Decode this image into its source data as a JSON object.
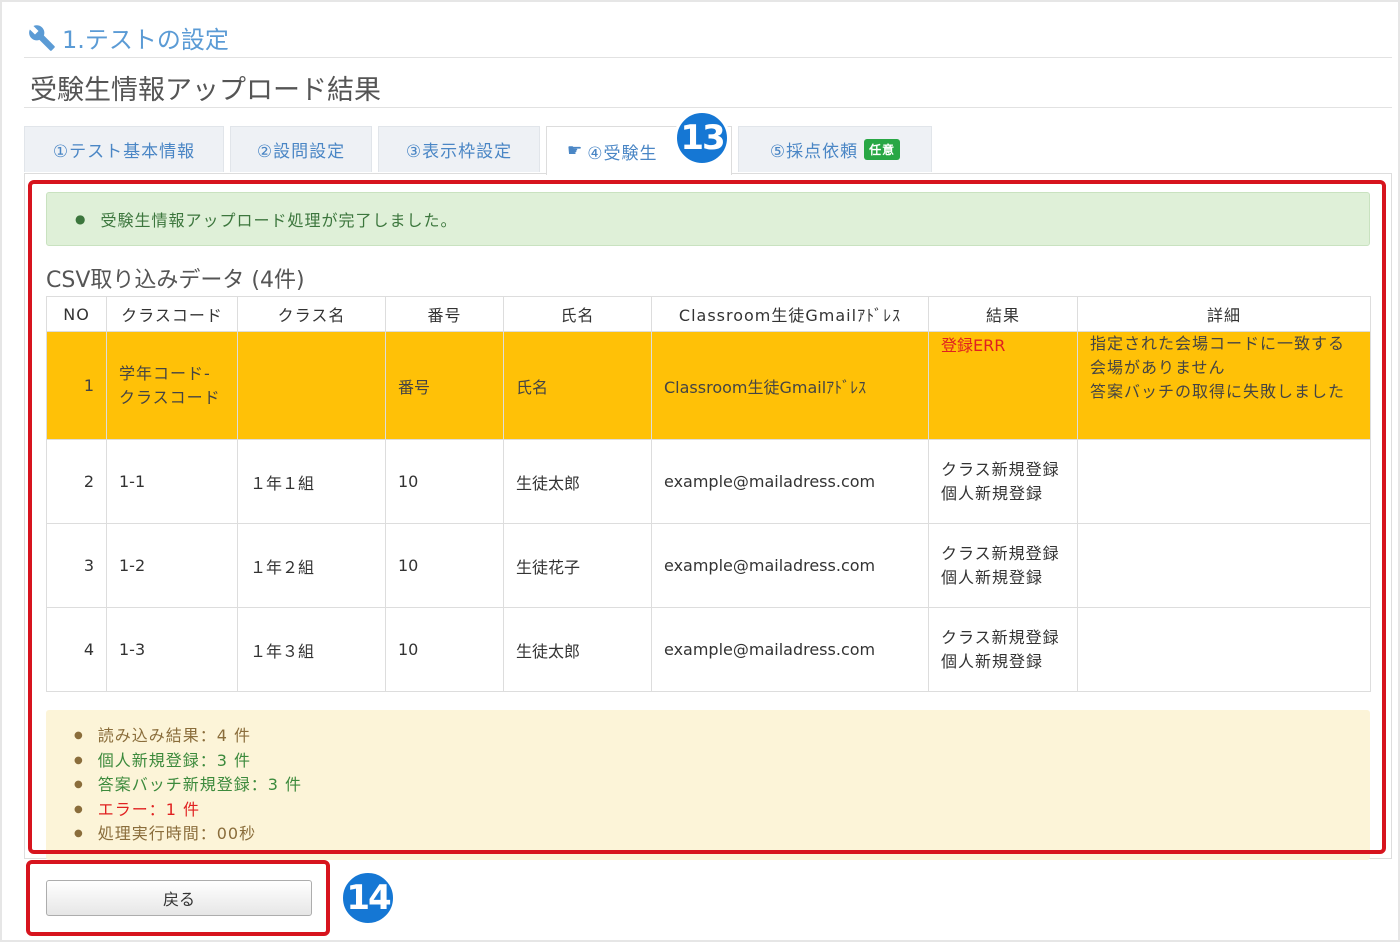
{
  "section_header": "1.テストの設定",
  "page_title": "受験生情報アップロード結果",
  "tabs": [
    {
      "label": "①テスト基本情報"
    },
    {
      "label": "②設問設定"
    },
    {
      "label": "③表示枠設定"
    },
    {
      "label": "④受験生"
    },
    {
      "label": "⑤採点依頼",
      "badge": "任意"
    }
  ],
  "success_message": "受験生情報アップロード処理が完了しました。",
  "csv_heading": "CSV取り込みデータ (4件)",
  "table": {
    "headers": [
      "NO",
      "クラスコード",
      "クラス名",
      "番号",
      "氏名",
      "Classroom生徒Gmailｱﾄﾞﾚｽ",
      "結果",
      "詳細"
    ],
    "rows": [
      {
        "no": "1",
        "class_code": "学年コード-クラスコード",
        "class_name": "",
        "number": "番号",
        "name": "氏名",
        "email": "Classroom生徒Gmailｱﾄﾞﾚｽ",
        "result_lines": [
          "登録ERR"
        ],
        "detail_lines": [
          "指定された会場コードに一致する会場がありません",
          "答案バッチの取得に失敗しました"
        ],
        "status": "error"
      },
      {
        "no": "2",
        "class_code": "1-1",
        "class_name": "１年１組",
        "number": "10",
        "name": "生徒太郎",
        "email": "example@mailadress.com",
        "result_lines": [
          "クラス新規登録",
          "個人新規登録"
        ],
        "detail_lines": [],
        "status": "ok"
      },
      {
        "no": "3",
        "class_code": "1-2",
        "class_name": "１年２組",
        "number": "10",
        "name": "生徒花子",
        "email": "example@mailadress.com",
        "result_lines": [
          "クラス新規登録",
          "個人新規登録"
        ],
        "detail_lines": [],
        "status": "ok"
      },
      {
        "no": "4",
        "class_code": "1-3",
        "class_name": "１年３組",
        "number": "10",
        "name": "生徒太郎",
        "email": "example@mailadress.com",
        "result_lines": [
          "クラス新規登録",
          "個人新規登録"
        ],
        "detail_lines": [],
        "status": "ok"
      }
    ]
  },
  "summary": [
    {
      "label": "読み込み結果：",
      "value": "4 件",
      "tone": "brown"
    },
    {
      "label": "個人新規登録：",
      "value": "3 件",
      "tone": "green"
    },
    {
      "label": "答案バッチ新規登録：",
      "value": "3 件",
      "tone": "green"
    },
    {
      "label": "エラー：",
      "value": "1 件",
      "tone": "red"
    },
    {
      "label": "処理実行時間：",
      "value": "00秒",
      "tone": "brown"
    }
  ],
  "back_button": "戻る",
  "step_badges": [
    "13",
    "14"
  ],
  "colors": {
    "accent_blue": "#5b9bd5",
    "error_row": "#ffc107",
    "success_bg": "#dff0d8",
    "summary_bg": "#fcf4d8",
    "highlight_red": "#d7141e",
    "badge_blue": "#1577d4"
  },
  "icons": {
    "section": "wrench-icon",
    "active_tab": "hand-pointer-icon"
  }
}
